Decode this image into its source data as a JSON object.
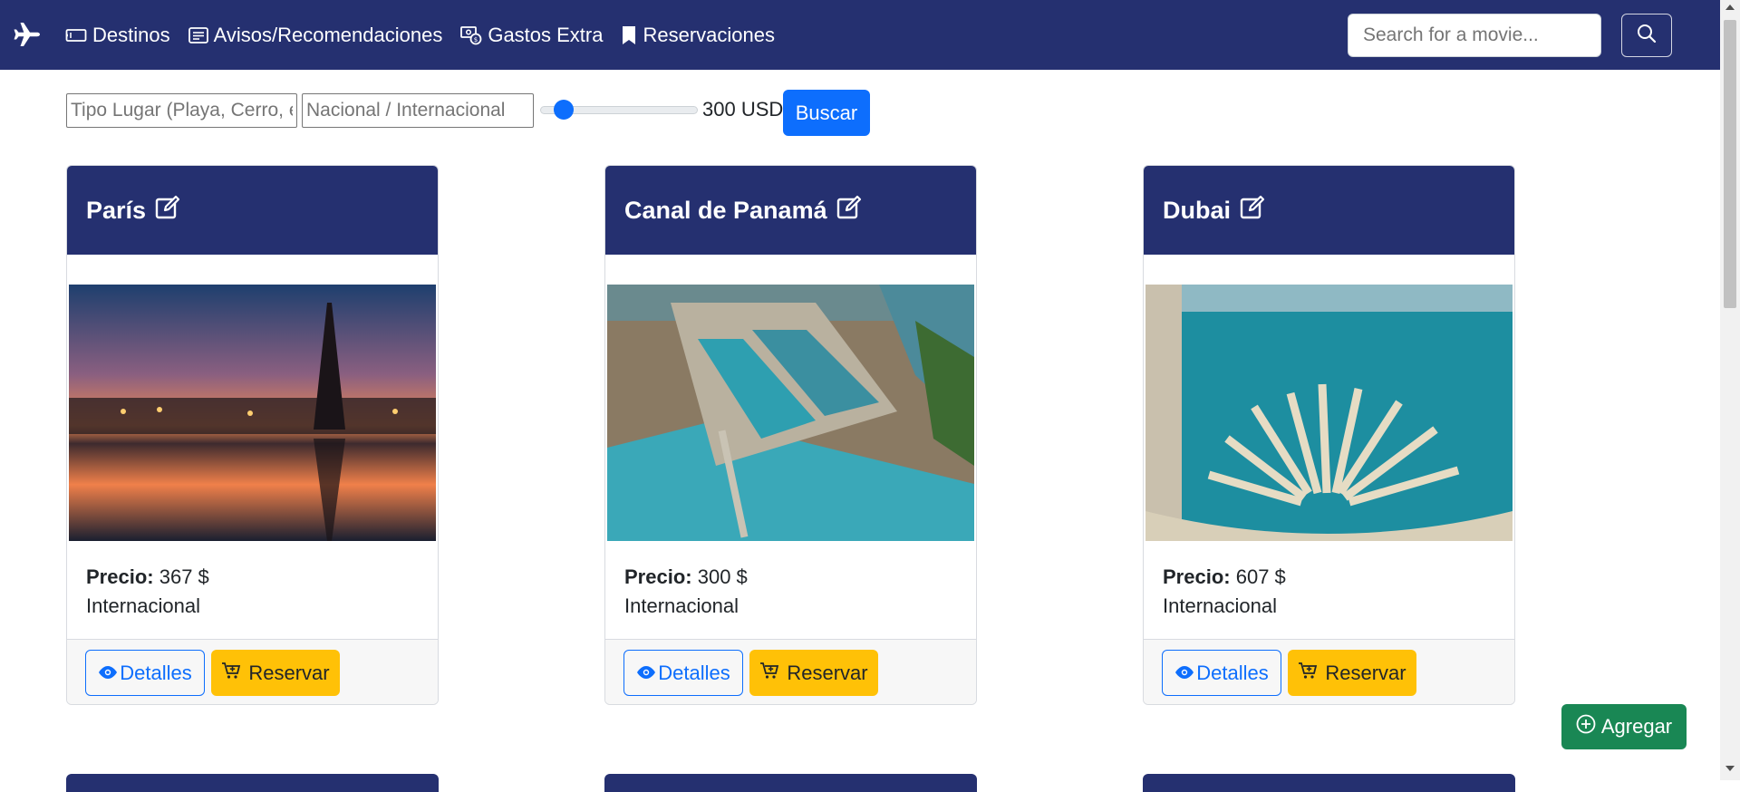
{
  "nav": {
    "brand_icon": "airplane-icon",
    "links": [
      {
        "label": "Destinos",
        "icon": "ticket-icon"
      },
      {
        "label": "Avisos/Recomendaciones",
        "icon": "card-text-icon"
      },
      {
        "label": "Gastos Extra",
        "icon": "cash-coin-icon"
      },
      {
        "label": "Reservaciones",
        "icon": "bookmark-icon"
      }
    ],
    "search_placeholder": "Search for a movie...",
    "search_icon": "search-icon"
  },
  "filters": {
    "tipo_placeholder": "Tipo Lugar (Playa, Cerro, etc)",
    "nacional_placeholder": "Nacional / Internacional",
    "price_value": "300 USD",
    "price_slider_fraction": 0.1,
    "buscar_label": "Buscar"
  },
  "cards": [
    {
      "title": "París",
      "price_label": "Precio:",
      "price": "367 $",
      "type": "Internacional",
      "details_label": "Detalles",
      "reserve_label": "Reservar"
    },
    {
      "title": "Canal de Panamá",
      "price_label": "Precio:",
      "price": "300 $",
      "type": "Internacional",
      "details_label": "Detalles",
      "reserve_label": "Reservar"
    },
    {
      "title": "Dubai",
      "price_label": "Precio:",
      "price": "607 $",
      "type": "Internacional",
      "details_label": "Detalles",
      "reserve_label": "Reservar"
    }
  ],
  "add_button": {
    "label": "Agregar",
    "icon": "plus-circle-icon"
  },
  "colors": {
    "navbar": "#253070",
    "primary": "#0d6efd",
    "warning": "#ffc107",
    "success": "#198754"
  }
}
